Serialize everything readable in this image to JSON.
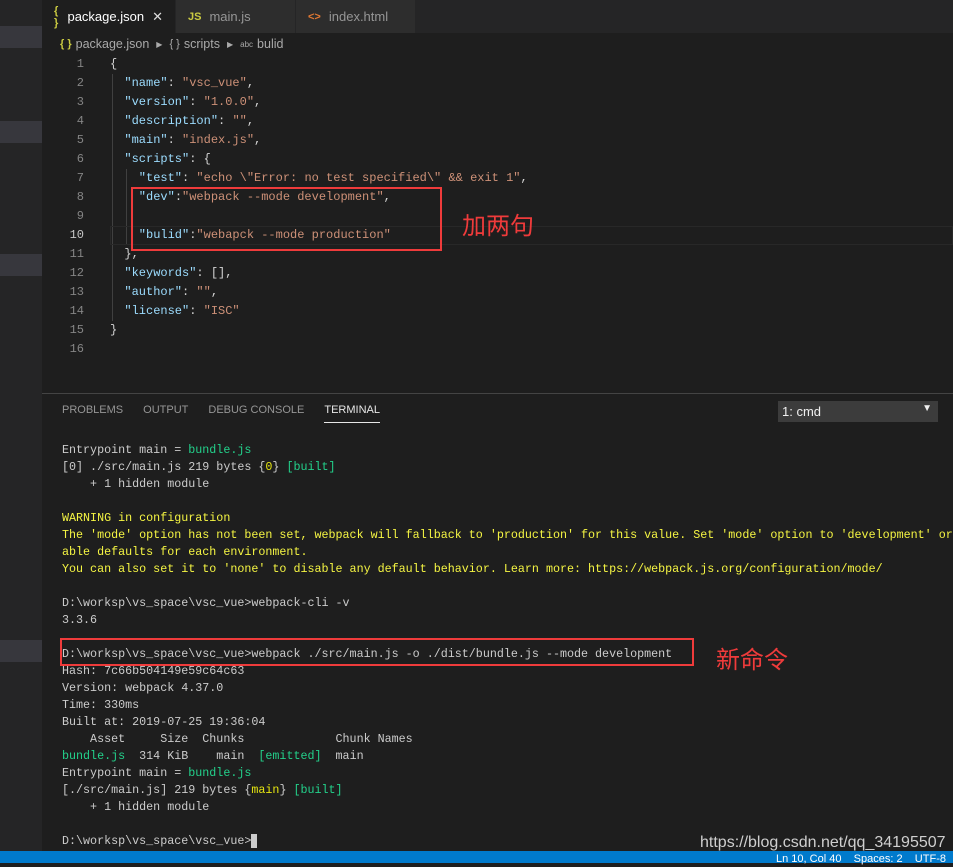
{
  "tabs": [
    {
      "icon": "{ }",
      "icon_color": "#cbcb41",
      "label": "package.json",
      "active": true,
      "close": "✕"
    },
    {
      "icon": "JS",
      "icon_color": "#cbcb41",
      "label": "main.js"
    },
    {
      "icon": "<>",
      "icon_color": "#e37933",
      "label": "index.html"
    }
  ],
  "breadcrumb": {
    "file_icon": "{ }",
    "file": "package.json",
    "scripts_icon": "{ }",
    "scripts": "scripts",
    "bulid_icon": "abc",
    "bulid": "bulid"
  },
  "editor": {
    "current_line": 10,
    "lines": [
      [
        [
          "p",
          "{"
        ]
      ],
      [
        [
          "k",
          "  \"name\""
        ],
        [
          "p",
          ": "
        ],
        [
          "s",
          "\"vsc_vue\""
        ],
        [
          "p",
          ","
        ]
      ],
      [
        [
          "k",
          "  \"version\""
        ],
        [
          "p",
          ": "
        ],
        [
          "s",
          "\"1.0.0\""
        ],
        [
          "p",
          ","
        ]
      ],
      [
        [
          "k",
          "  \"description\""
        ],
        [
          "p",
          ": "
        ],
        [
          "s",
          "\"\""
        ],
        [
          "p",
          ","
        ]
      ],
      [
        [
          "k",
          "  \"main\""
        ],
        [
          "p",
          ": "
        ],
        [
          "s",
          "\"index.js\""
        ],
        [
          "p",
          ","
        ]
      ],
      [
        [
          "k",
          "  \"scripts\""
        ],
        [
          "p",
          ": {"
        ]
      ],
      [
        [
          "k",
          "    \"test\""
        ],
        [
          "p",
          ": "
        ],
        [
          "s",
          "\"echo \\\"Error: no test specified\\\" && exit 1\""
        ],
        [
          "p",
          ","
        ]
      ],
      [
        [
          "k",
          "    \"dev\""
        ],
        [
          "p",
          ":"
        ],
        [
          "s",
          "\"webpack --mode development\""
        ],
        [
          "p",
          ","
        ]
      ],
      [],
      [
        [
          "k",
          "    \"bulid\""
        ],
        [
          "p",
          ":"
        ],
        [
          "s",
          "\"webapck --mode production\""
        ]
      ],
      [
        [
          "p",
          "  },"
        ]
      ],
      [
        [
          "k",
          "  \"keywords\""
        ],
        [
          "p",
          ": [],"
        ]
      ],
      [
        [
          "k",
          "  \"author\""
        ],
        [
          "p",
          ": "
        ],
        [
          "s",
          "\"\""
        ],
        [
          "p",
          ","
        ]
      ],
      [
        [
          "k",
          "  \"license\""
        ],
        [
          "p",
          ": "
        ],
        [
          "s",
          "\"ISC\""
        ]
      ],
      [
        [
          "p",
          "}"
        ]
      ],
      []
    ]
  },
  "panel": {
    "tabs": [
      "PROBLEMS",
      "OUTPUT",
      "DEBUG CONSOLE",
      "TERMINAL"
    ],
    "active_tab": "TERMINAL",
    "terminal_select": "1: cmd",
    "terminal_lines": [
      [
        [
          "w",
          "Entrypoint main = "
        ],
        [
          "g",
          "bundle.js"
        ]
      ],
      [
        [
          "w",
          "[0] ./src/main.js 219 bytes {"
        ],
        [
          "y",
          "0"
        ],
        [
          "w",
          "} "
        ],
        [
          "g",
          "[built]"
        ]
      ],
      [
        [
          "w",
          "    + 1 hidden module"
        ]
      ],
      [],
      [
        [
          "yb",
          "WARNING in configuration"
        ]
      ],
      [
        [
          "yb",
          "The 'mode' option has not been set, webpack will fallback to 'production' for this value. Set 'mode' option to 'development' or"
        ]
      ],
      [
        [
          "yb",
          "able defaults for each environment."
        ]
      ],
      [
        [
          "yb",
          "You can also set it to 'none' to disable any default behavior. Learn more: https://webpack.js.org/configuration/mode/"
        ]
      ],
      [],
      [
        [
          "w",
          "D:\\worksp\\vs_space\\vsc_vue>webpack-cli -v"
        ]
      ],
      [
        [
          "w",
          "3.3.6"
        ]
      ],
      [],
      [
        [
          "w",
          "D:\\worksp\\vs_space\\vsc_vue>webpack ./src/main.js -o ./dist/bundle.js --mode development"
        ]
      ],
      [
        [
          "w",
          "Hash: 7c66b504149e59c64c63"
        ]
      ],
      [
        [
          "w",
          "Version: webpack 4.37.0"
        ]
      ],
      [
        [
          "w",
          "Time: 330ms"
        ]
      ],
      [
        [
          "w",
          "Built at: 2019-07-25 19:36:04"
        ]
      ],
      [
        [
          "w",
          "    Asset     Size  Chunks             Chunk Names"
        ]
      ],
      [
        [
          "g",
          "bundle.js"
        ],
        [
          "w",
          "  314 KiB    main  "
        ],
        [
          "g",
          "[emitted]"
        ],
        [
          "w",
          "  main"
        ]
      ],
      [
        [
          "w",
          "Entrypoint main = "
        ],
        [
          "g",
          "bundle.js"
        ]
      ],
      [
        [
          "w",
          "[./src/main.js] 219 bytes {"
        ],
        [
          "y",
          "main"
        ],
        [
          "w",
          "} "
        ],
        [
          "g",
          "[built]"
        ]
      ],
      [
        [
          "w",
          "    + 1 hidden module"
        ]
      ],
      [],
      [
        [
          "w",
          "D:\\worksp\\vs_space\\vsc_vue>"
        ]
      ]
    ]
  },
  "annotations": {
    "add_two": "加两句",
    "new_command": "新命令"
  },
  "watermark": "https://blog.csdn.net/qq_34195507",
  "status": {
    "text": "Ln 10, Col 40    Spaces: 2    UTF-8"
  }
}
